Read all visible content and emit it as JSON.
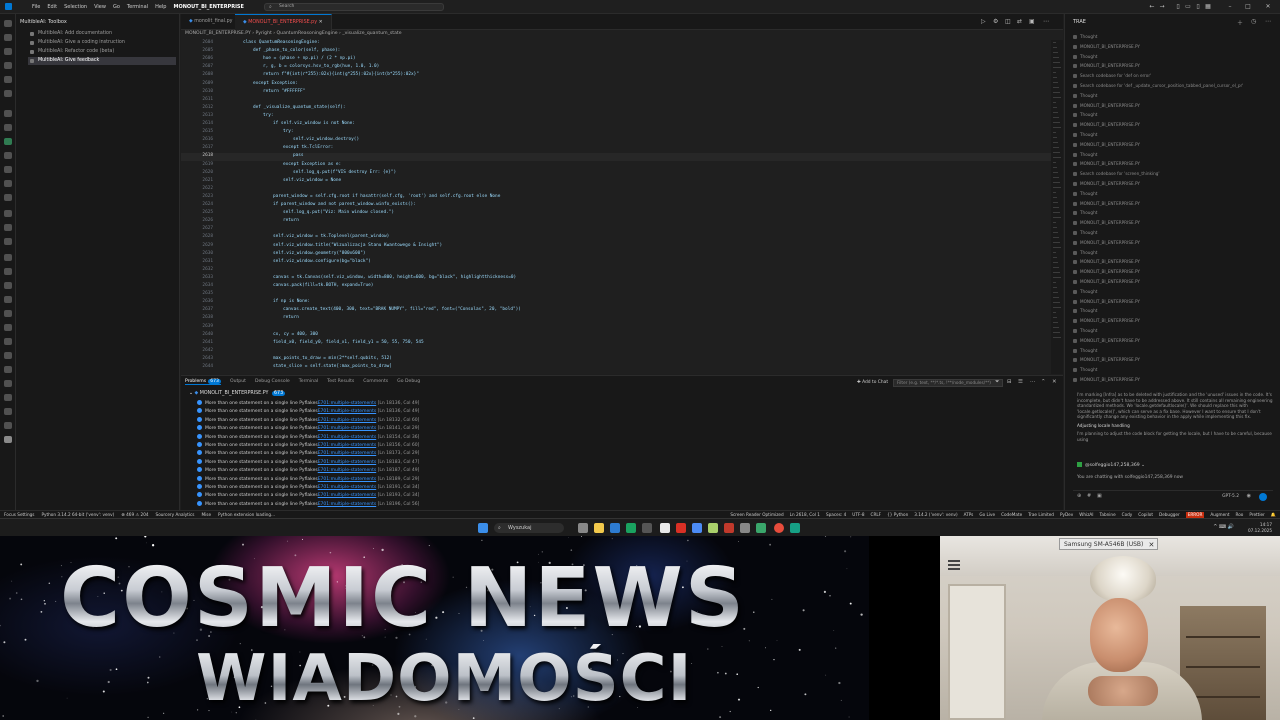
{
  "titlebar": {
    "menus": [
      "File",
      "Edit",
      "Selection",
      "View",
      "Go",
      "Terminal",
      "Help"
    ],
    "window_title": "MONOUT_BI_ENTERPRISE",
    "search_placeholder": "Search"
  },
  "sidebar": {
    "title": "MultibleAI: Toolbox",
    "items": [
      {
        "label": "MultibleAI: Add documentation"
      },
      {
        "label": "MultibleAI: Give a coding instruction"
      },
      {
        "label": "MultibleAI: Refactor code (beta)"
      },
      {
        "label": "MultibleAI: Give feedback"
      }
    ]
  },
  "editor": {
    "tabs": [
      {
        "label": "monolit_final.py"
      },
      {
        "label": "MONOLIT_BI_ENTERPRISE.py"
      }
    ],
    "breadcrumb": "MONOLIT_BI_ENTERPRISE.PY  ›  Pyright  ›  QuantumReasoningEngine  ›  _visualize_quantum_state",
    "line_numbers": [
      "2604",
      "2605",
      "2606",
      "2607",
      "2608",
      "2609",
      "2610",
      "2611",
      "2612",
      "2613",
      "2614",
      "2615",
      "2616",
      "2617",
      "2618",
      "2619",
      "2620",
      "2621",
      "2622",
      "2623",
      "2624",
      "2625",
      "2626",
      "2627",
      "2628",
      "2629",
      "2630",
      "2631",
      "2632",
      "2633",
      "2634",
      "2635",
      "2636",
      "2637",
      "2638",
      "2639",
      "2640",
      "2641",
      "2642",
      "2643",
      "2644"
    ],
    "current_line": "2618",
    "code_lines": [
      {
        "indent": 2,
        "text": "class QuantumReasoningEngine:"
      },
      {
        "indent": 3,
        "text": "def _phase_to_color(self, phase):"
      },
      {
        "indent": 4,
        "text": "hue = (phase + np.pi) / (2 * np.pi)"
      },
      {
        "indent": 4,
        "text": "r, g, b = colorsys.hsv_to_rgb(hue, 1.0, 1.0)"
      },
      {
        "indent": 4,
        "text": "return f\"#{int(r*255):02x}{int(g*255):02x}{int(b*255):02x}\""
      },
      {
        "indent": 3,
        "text": "except Exception:"
      },
      {
        "indent": 4,
        "text": "return \"#FFFFFF\""
      },
      {
        "indent": 0,
        "text": ""
      },
      {
        "indent": 3,
        "text": "def _visualize_quantum_state(self):"
      },
      {
        "indent": 4,
        "text": "try:"
      },
      {
        "indent": 5,
        "text": "if self.viz_window is not None:"
      },
      {
        "indent": 6,
        "text": "try:"
      },
      {
        "indent": 7,
        "text": "self.viz_window.destroy()"
      },
      {
        "indent": 6,
        "text": "except tk.TclError:"
      },
      {
        "indent": 7,
        "text": "pass"
      },
      {
        "indent": 6,
        "text": "except Exception as e:"
      },
      {
        "indent": 7,
        "text": "self.log_q.put(f\"VIS destroy Err: {e}\")"
      },
      {
        "indent": 6,
        "text": "self.viz_window = None"
      },
      {
        "indent": 0,
        "text": ""
      },
      {
        "indent": 5,
        "text": "parent_window = self.cfg.root if hasattr(self.cfg, 'root') and self.cfg.root else None"
      },
      {
        "indent": 5,
        "text": "if parent_window and not parent_window.winfo_exists():"
      },
      {
        "indent": 6,
        "text": "self.log_q.put(\"Viz: Main window closed.\")"
      },
      {
        "indent": 6,
        "text": "return"
      },
      {
        "indent": 0,
        "text": ""
      },
      {
        "indent": 5,
        "text": "self.viz_window = tk.Toplevel(parent_window)"
      },
      {
        "indent": 5,
        "text": "self.viz_window.title(\"Wizualizacja Stanu Kwantowego & Insight\")"
      },
      {
        "indent": 5,
        "text": "self.viz_window.geometry(\"800x600\")"
      },
      {
        "indent": 5,
        "text": "self.viz_window.configure(bg=\"black\")"
      },
      {
        "indent": 0,
        "text": ""
      },
      {
        "indent": 5,
        "text": "canvas = tk.Canvas(self.viz_window, width=800, height=600, bg=\"black\", highlightthickness=0)"
      },
      {
        "indent": 5,
        "text": "canvas.pack(fill=tk.BOTH, expand=True)"
      },
      {
        "indent": 0,
        "text": ""
      },
      {
        "indent": 5,
        "text": "if np is None:"
      },
      {
        "indent": 6,
        "text": "canvas.create_text(400, 300, text=\"BRAK NUMPY\", fill=\"red\", font=(\"Consolas\", 20, \"bold\"))"
      },
      {
        "indent": 6,
        "text": "return"
      },
      {
        "indent": 0,
        "text": ""
      },
      {
        "indent": 5,
        "text": "cx, cy = 400, 300"
      },
      {
        "indent": 5,
        "text": "field_x0, field_y0, field_x1, field_y1 = 50, 55, 750, 545"
      },
      {
        "indent": 0,
        "text": ""
      },
      {
        "indent": 5,
        "text": "max_points_to_draw = min(2**self.qubits, 512)"
      },
      {
        "indent": 5,
        "text": "state_slice = self.state[:max_points_to_draw]"
      }
    ]
  },
  "panel": {
    "tabs": [
      "Problems",
      "Output",
      "Debug Console",
      "Terminal",
      "Test Results",
      "Comments",
      "Go Debug"
    ],
    "problems_count": "673",
    "add_to_chat": "Add to Chat",
    "filter_placeholder": "Filter (e.g. text, **/*.ts, !**/node_modules/**)",
    "file": "MONOLIT_BI_ENTERPRISE.PY",
    "file_count": "673",
    "problems": [
      {
        "msg": "More than one statement on a single line",
        "source": "Pyflakes",
        "code": "E701:multiple-statements",
        "loc": "[Ln 18136, Col 49]"
      },
      {
        "msg": "More than one statement on a single line",
        "source": "Pyflakes",
        "code": "E701:multiple-statements",
        "loc": "[Ln 18136, Col 49]"
      },
      {
        "msg": "More than one statement on a single line",
        "source": "Pyflakes",
        "code": "E701:multiple-statements",
        "loc": "[Ln 18132, Col 60]"
      },
      {
        "msg": "More than one statement on a single line",
        "source": "Pyflakes",
        "code": "E701:multiple-statements",
        "loc": "[Ln 18141, Col 29]"
      },
      {
        "msg": "More than one statement on a single line",
        "source": "Pyflakes",
        "code": "E701:multiple-statements",
        "loc": "[Ln 18154, Col 36]"
      },
      {
        "msg": "More than one statement on a single line",
        "source": "Pyflakes",
        "code": "E701:multiple-statements",
        "loc": "[Ln 18156, Col 60]"
      },
      {
        "msg": "More than one statement on a single line",
        "source": "Pyflakes",
        "code": "E701:multiple-statements",
        "loc": "[Ln 18173, Col 29]"
      },
      {
        "msg": "More than one statement on a single line",
        "source": "Pyflakes",
        "code": "E701:multiple-statements",
        "loc": "[Ln 18183, Col 47]"
      },
      {
        "msg": "More than one statement on a single line",
        "source": "Pyflakes",
        "code": "E701:multiple-statements",
        "loc": "[Ln 18187, Col 49]"
      },
      {
        "msg": "More than one statement on a single line",
        "source": "Pyflakes",
        "code": "E701:multiple-statements",
        "loc": "[Ln 18189, Col 29]"
      },
      {
        "msg": "More than one statement on a single line",
        "source": "Pyflakes",
        "code": "E701:multiple-statements",
        "loc": "[Ln 18191, Col 34]"
      },
      {
        "msg": "More than one statement on a single line",
        "source": "Pyflakes",
        "code": "E701:multiple-statements",
        "loc": "[Ln 18193, Col 34]"
      },
      {
        "msg": "More than one statement on a single line",
        "source": "Pyflakes",
        "code": "E701:multiple-statements",
        "loc": "[Ln 18196, Col 56]"
      }
    ]
  },
  "chat": {
    "title": "TRAE",
    "history": [
      "Thought",
      "MONOLIT_BI_ENTERPRISE.PY",
      "Thought",
      "MONOLIT_BI_ENTERPRISE.PY",
      "Search codebase for 'def on error'",
      "Search codebase for 'def _update_cursor_position_tabbed_panel_cursor_el_pr'",
      "Thought",
      "MONOLIT_BI_ENTERPRISE.PY",
      "Thought",
      "MONOLIT_BI_ENTERPRISE.PY",
      "Thought",
      "MONOLIT_BI_ENTERPRISE.PY",
      "Thought",
      "MONOLIT_BI_ENTERPRISE.PY",
      "Search codebase for 'screen_thinking'",
      "MONOLIT_BI_ENTERPRISE.PY",
      "Thought",
      "MONOLIT_BI_ENTERPRISE.PY",
      "Thought",
      "MONOLIT_BI_ENTERPRISE.PY",
      "Thought",
      "MONOLIT_BI_ENTERPRISE.PY",
      "Thought",
      "MONOLIT_BI_ENTERPRISE.PY",
      "MONOLIT_BI_ENTERPRISE.PY",
      "MONOLIT_BI_ENTERPRISE.PY",
      "Thought",
      "MONOLIT_BI_ENTERPRISE.PY",
      "Thought",
      "MONOLIT_BI_ENTERPRISE.PY",
      "Thought",
      "MONOLIT_BI_ENTERPRISE.PY",
      "Thought",
      "MONOLIT_BI_ENTERPRISE.PY",
      "Thought",
      "MONOLIT_BI_ENTERPRISE.PY"
    ],
    "message": "I'm marking [Infra] as to be deleted with justification and the 'unused' issues in the code. It's incomplete, but didn't have to be addressed above. It still contains all remaining engineering standardized methods. We 'locale.getdefaultlocale()'. We should replace this with 'locale.getlocale()', which can serve as a fix base. However I want to ensure that I don't significantly change any existing behavior in the apply while implementing this fix.",
    "heading": "Adjusting locale handling",
    "status": "I'm planning to adjust the code block for getting the locale, but I have to be careful, because using",
    "user": "@solfeggio147,258,369",
    "note": "You are chatting with solfeggio147,258,369 now",
    "model": "GPT-5.2"
  },
  "statusbar": {
    "left": [
      "Focus Settings",
      "Python 3.14.2 64-bit ('venv': venv)",
      "⊗ 469  ⚠ 204",
      "Sourcery Analytics",
      "Mise",
      "Python extension loading..."
    ],
    "right": [
      "Screen Reader Optimized",
      "Ln 2618, Col 1",
      "Spaces: 4",
      "UTF-8",
      "CRLF",
      "{} Python",
      "3.14.2 ('venv': venv)",
      "ATPs",
      "Go Live",
      "CodeMate",
      "Trae Limited",
      "PyDev",
      "WhizAI",
      "Tabnine",
      "Cody",
      "Copilot",
      "Debugger",
      "Augment",
      "Roo",
      "Prettier"
    ],
    "error_chip": "ERROR"
  },
  "taskbar": {
    "search_placeholder": "Wyszukaj",
    "time": "14:17",
    "date": "07.12.2025",
    "tray": "^  ⌨  🔊"
  },
  "overlay": {
    "news_title": "COSMIC NEWS",
    "news_subtitle": "WIADOMOŚCI",
    "camera_label": "Samsung SM-A546B (USB)"
  },
  "colors": {
    "editor_bg": "#1f1f1f",
    "accent": "#0078d4",
    "error_tab": "#f14c4c",
    "link": "#3794ff"
  }
}
